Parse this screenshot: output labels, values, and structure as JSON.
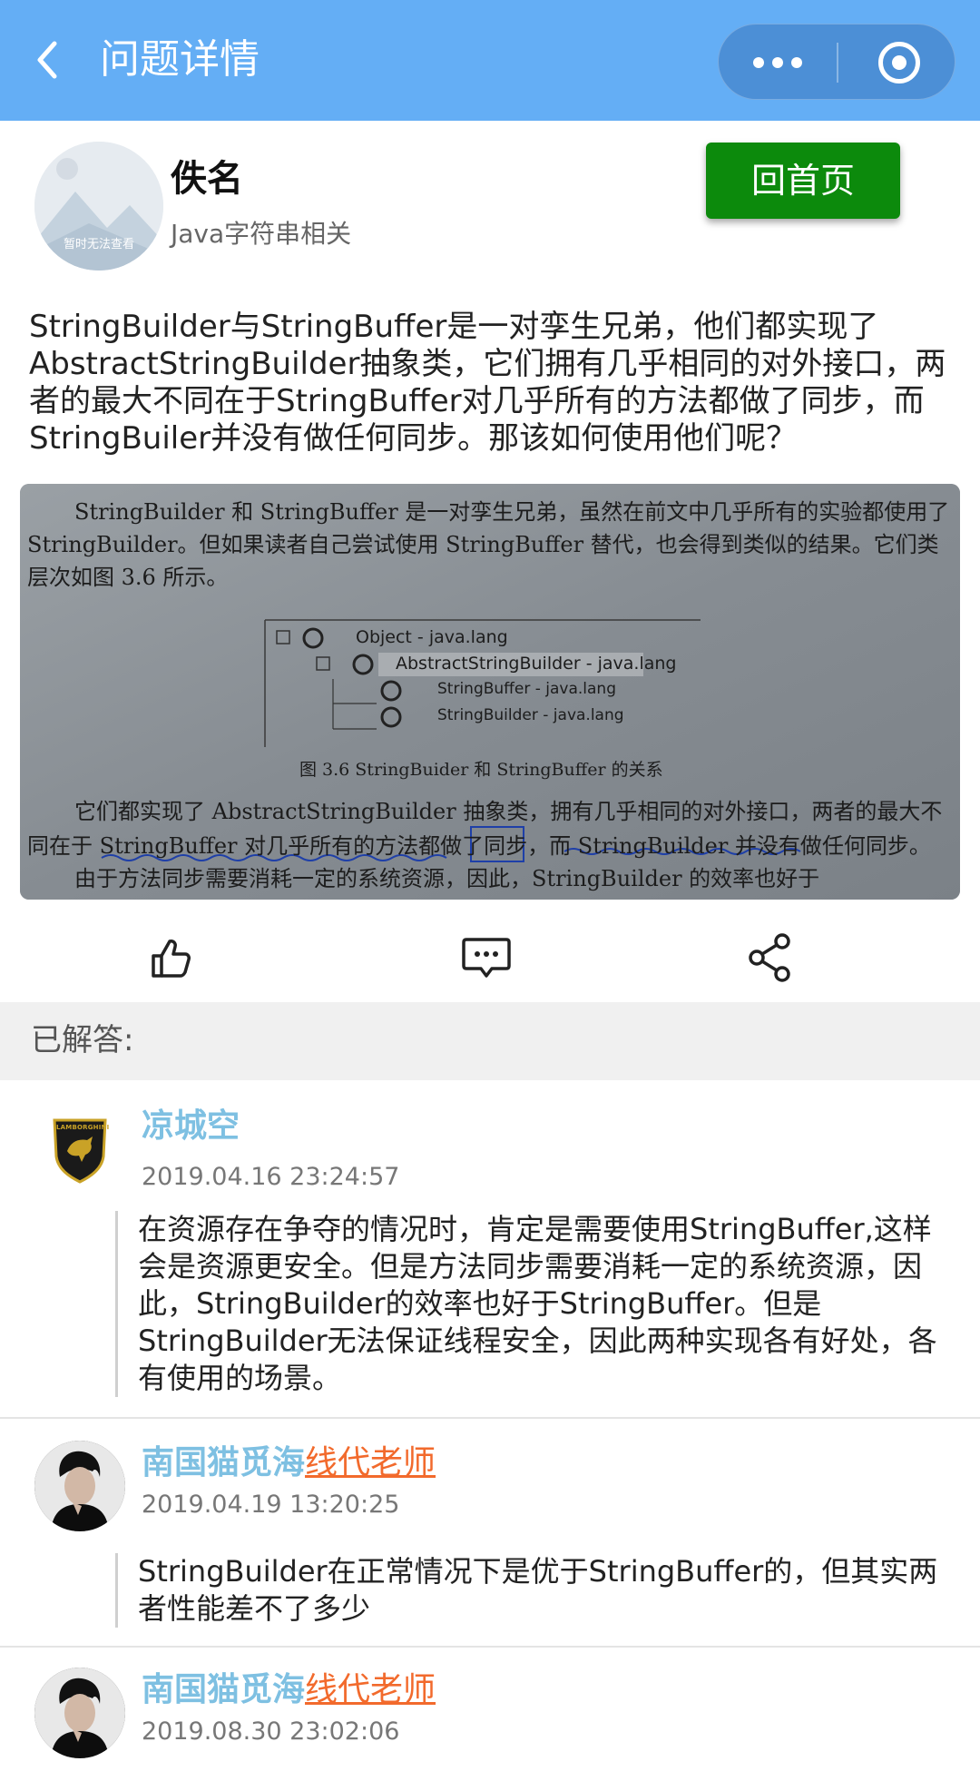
{
  "navbar": {
    "title": "问题详情",
    "back_icon": "chevron-left-icon",
    "more_icon": "more-dots-icon",
    "close_icon": "target-close-icon",
    "color": "#64aef5"
  },
  "asker": {
    "name": "佚名",
    "tag": "Java字符串相关",
    "avatar_placeholder_text": "暂时无法查看",
    "home_button": "回首页",
    "home_button_color": "#0c8a0c"
  },
  "question": {
    "text": "StringBuilder与StringBuffer是一对孪生兄弟，他们都实现了AbstractStringBuilder抽象类，它们拥有几乎相同的对外接口，两者的最大不同在于StringBuffer对几乎所有的方法都做了同步，而StringBuiler并没有做任何同步。那该如何使用他们呢？",
    "image": {
      "line1": "StringBuilder 和 StringBuffer 是一对孪生兄弟，虽然在前文中几乎所有的实验都使用了",
      "line2": "StringBuilder。但如果读者自己尝试使用 StringBuffer 替代，也会得到类似的结果。它们类",
      "line3": "层次如图 3.6 所示。",
      "tree_object": "Object - java.lang",
      "tree_abstract": "AbstractStringBuilder - java.lang",
      "tree_buffer": "StringBuffer - java.lang",
      "tree_builder": "StringBuilder - java.lang",
      "caption": "图 3.6   StringBuider 和 StringBuffer 的关系",
      "line4": "它们都实现了 AbstractStringBuilder 抽象类，拥有几乎相同的对外接口，两者的最大不",
      "line5": "同在于 StringBuffer 对几乎所有的方法都做了同步，而 StringBuilder 并没有做任何同步。",
      "line6": "由于方法同步需要消耗一定的系统资源，因此，StringBuilder 的效率也好于"
    }
  },
  "actions": {
    "like_icon": "thumbs-up-icon",
    "comment_icon": "comment-icon",
    "share_icon": "share-icon"
  },
  "answered_label": "已解答:",
  "answers": [
    {
      "name": "凉城空",
      "role": "",
      "time": "2019.04.16 23:24:57",
      "avatar": "lamborghini-logo",
      "avatar_text": "LAMBORGHINI",
      "body": "在资源存在争夺的情况时，肯定是需要使用StringBuffer,这样会是资源更安全。但是方法同步需要消耗一定的系统资源，因此，StringBuilder的效率也好于StringBuffer。但是StringBuilder无法保证线程安全，因此两种实现各有好处，各有使用的场景。"
    },
    {
      "name": "南国猫觅海",
      "role": "线代老师",
      "time": "2019.04.19 13:20:25",
      "avatar": "person-photo",
      "body": "StringBuilder在正常情况下是优于StringBuffer的，但其实两者性能差不了多少"
    },
    {
      "name": "南国猫觅海",
      "role": "线代老师",
      "time": "2019.08.30 23:02:06",
      "avatar": "person-photo",
      "body": ""
    }
  ]
}
